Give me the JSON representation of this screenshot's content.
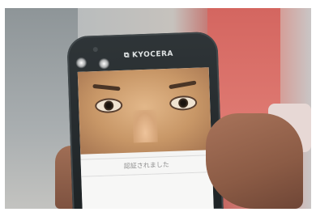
{
  "phone": {
    "brand": "KYOCERA",
    "screen_status_text": "認証されました"
  },
  "colors": {
    "phone_body": "#22282a",
    "screen_bg": "#f4f4f3",
    "status_text": "#8e8e8e",
    "background_red": "#d46660"
  },
  "icons": {
    "brand_mark": "kyocera-logo-icon"
  }
}
